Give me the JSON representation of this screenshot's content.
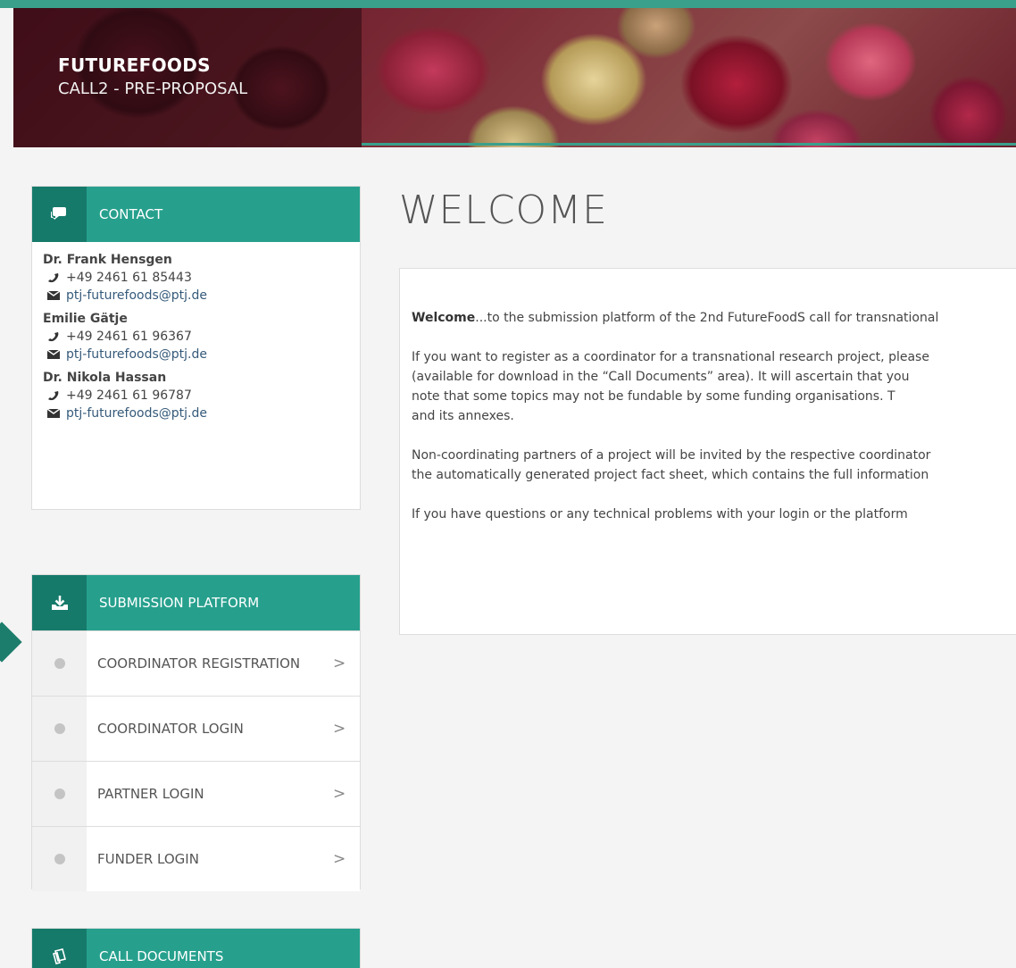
{
  "header": {
    "title": "FUTUREFOODS",
    "subtitle": "CALL2 - PRE-PROPOSAL"
  },
  "contact": {
    "heading": "CONTACT",
    "people": [
      {
        "name": "Dr. Frank Hensgen",
        "phone": "+49 2461 61 85443",
        "email": "ptj-futurefoods@ptj.de"
      },
      {
        "name": "Emilie Gätje",
        "phone": "+49 2461 61 96367",
        "email": "ptj-futurefoods@ptj.de"
      },
      {
        "name": "Dr. Nikola Hassan",
        "phone": "+49 2461 61 96787",
        "email": "ptj-futurefoods@ptj.de"
      }
    ]
  },
  "submission": {
    "heading": "SUBMISSION PLATFORM",
    "items": [
      {
        "label": "COORDINATOR REGISTRATION"
      },
      {
        "label": "COORDINATOR LOGIN"
      },
      {
        "label": "PARTNER LOGIN"
      },
      {
        "label": "FUNDER LOGIN"
      }
    ],
    "chevron": ">"
  },
  "documents": {
    "heading": "CALL DOCUMENTS"
  },
  "main": {
    "title": "WELCOME",
    "p1_bold": "Welcome",
    "p1_rest": "...to the submission platform of the 2nd FutureFoodS call for transnational",
    "p2_l1": " If you want to register as a coordinator for a transnational research project, please",
    "p2_l2": "(available for download in the “Call Documents” area). It will ascertain that you",
    "p2_l3": "note that some topics may not be fundable by some funding organisations. T",
    "p2_l4": "and its annexes.",
    "p3_l1": "Non-coordinating partners of a project will be invited by the respective coordinator",
    "p3_l2": "the automatically generated project fact sheet, which contains the full information",
    "p4": "If you have questions or any technical problems with your login or the platform"
  }
}
